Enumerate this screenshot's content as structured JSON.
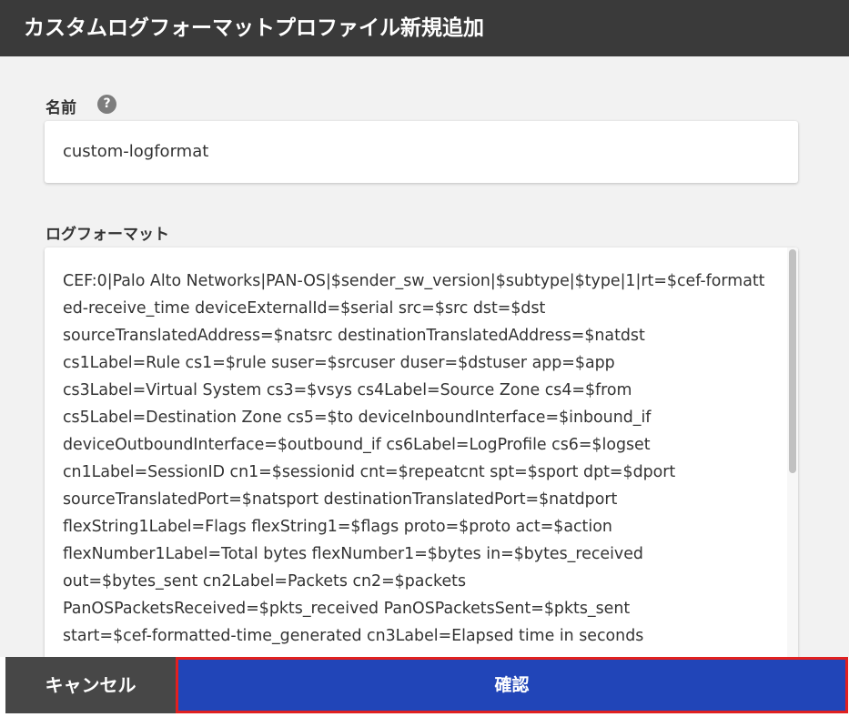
{
  "header": {
    "title": "カスタムログフォーマットプロファイル新規追加"
  },
  "name_field": {
    "label": "名前",
    "help_icon": "?",
    "value": "custom-logformat"
  },
  "log_format_field": {
    "label": "ログフォーマット",
    "value": "CEF:0|Palo Alto Networks|PAN-OS|$sender_sw_version|$subtype|$type|1|rt=$cef-formatted-receive_time deviceExternalId=$serial src=$src dst=$dst\nsourceTranslatedAddress=$natsrc destinationTranslatedAddress=$natdst\ncs1Label=Rule cs1=$rule suser=$srcuser duser=$dstuser app=$app\ncs3Label=Virtual System cs3=$vsys cs4Label=Source Zone cs4=$from\ncs5Label=Destination Zone cs5=$to deviceInboundInterface=$inbound_if\ndeviceOutboundInterface=$outbound_if cs6Label=LogProfile cs6=$logset\ncn1Label=SessionID cn1=$sessionid cnt=$repeatcnt spt=$sport dpt=$dport\nsourceTranslatedPort=$natsport destinationTranslatedPort=$natdport\nflexString1Label=Flags flexString1=$flags proto=$proto act=$action\nflexNumber1Label=Total bytes flexNumber1=$bytes in=$bytes_received\nout=$bytes_sent cn2Label=Packets cn2=$packets\nPanOSPacketsReceived=$pkts_received PanOSPacketsSent=$pkts_sent\nstart=$cef-formatted-time_generated cn3Label=Elapsed time in seconds"
  },
  "footer": {
    "cancel_label": "キャンセル",
    "confirm_label": "確認"
  },
  "colors": {
    "header_bg": "#3a3a3a",
    "confirm_bg": "#2145b8",
    "cancel_bg": "#474747",
    "highlight_border": "#e02020"
  }
}
